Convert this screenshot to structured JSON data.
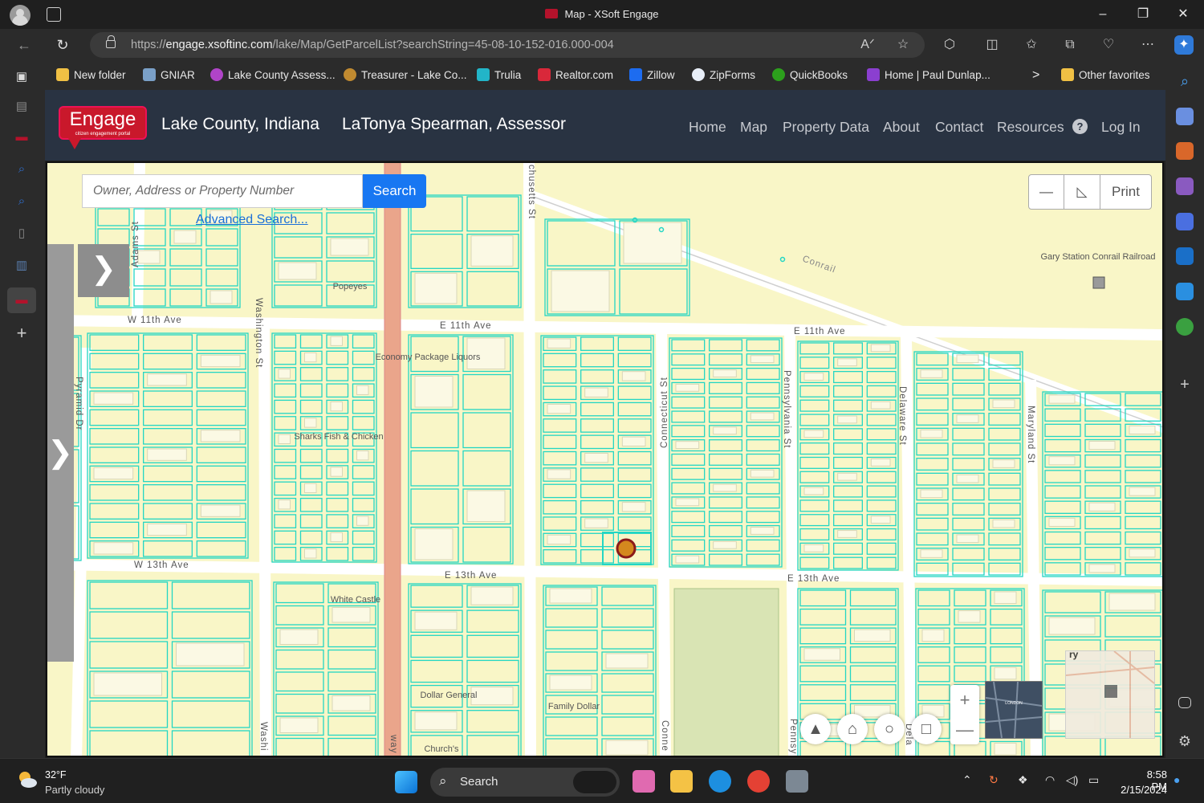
{
  "window": {
    "title": "Map - XSoft Engage"
  },
  "browser": {
    "url_prefix": "https://",
    "url_host": "engage.xsoftinc.com",
    "url_path": "/lake/Map/GetParcelList?searchString=45-08-10-152-016.000-004",
    "favorites": [
      "New folder",
      "GNIAR",
      "Lake County Assess...",
      "Treasurer - Lake Co...",
      "Trulia",
      "Realtor.com",
      "Zillow",
      "ZipForms",
      "QuickBooks",
      "Home | Paul Dunlap...",
      "Other favorites"
    ]
  },
  "header": {
    "logo_text": "Engage",
    "logo_tagline": "citizen engagement portal",
    "county": "Lake County, Indiana",
    "assessor": "LaTonya Spearman, Assessor",
    "nav": [
      "Home",
      "Map",
      "Property Data",
      "About",
      "Contact",
      "Resources",
      "Log In"
    ],
    "help": "?"
  },
  "map": {
    "search_placeholder": "Owner, Address or Property Number",
    "search_button": "Search",
    "advanced_search": "Advanced Search...",
    "print_label": "Print",
    "panel_toggle": "❯",
    "zoom_in": "+",
    "zoom_out": "—",
    "streets": [
      "W 11th Ave",
      "E 11th Ave",
      "E 11th Ave",
      "W 13th Ave",
      "E 13th Ave",
      "E 13th Ave",
      "Washington St",
      "Connecticut St",
      "Pennsylvania St",
      "Delaware St",
      "Maryland St",
      "Pyramid Dr",
      "Adams St",
      "chusetts St",
      "Washi",
      "Conne",
      "Pennsy",
      "Dela",
      "Conrail",
      "way"
    ],
    "places": [
      "Popeyes",
      "Economy Package Liquors",
      "Sharks Fish & Chicken",
      "White Castle",
      "Dollar General",
      "Family Dollar",
      "Church's",
      "Gary Station Conrail Railroad"
    ],
    "overview_label": "ry",
    "minimap_label": "LONDON"
  },
  "taskbar": {
    "temp": "32°F",
    "weather": "Partly cloudy",
    "search": "Search",
    "time": "8:58 PM",
    "date": "2/15/2024"
  }
}
